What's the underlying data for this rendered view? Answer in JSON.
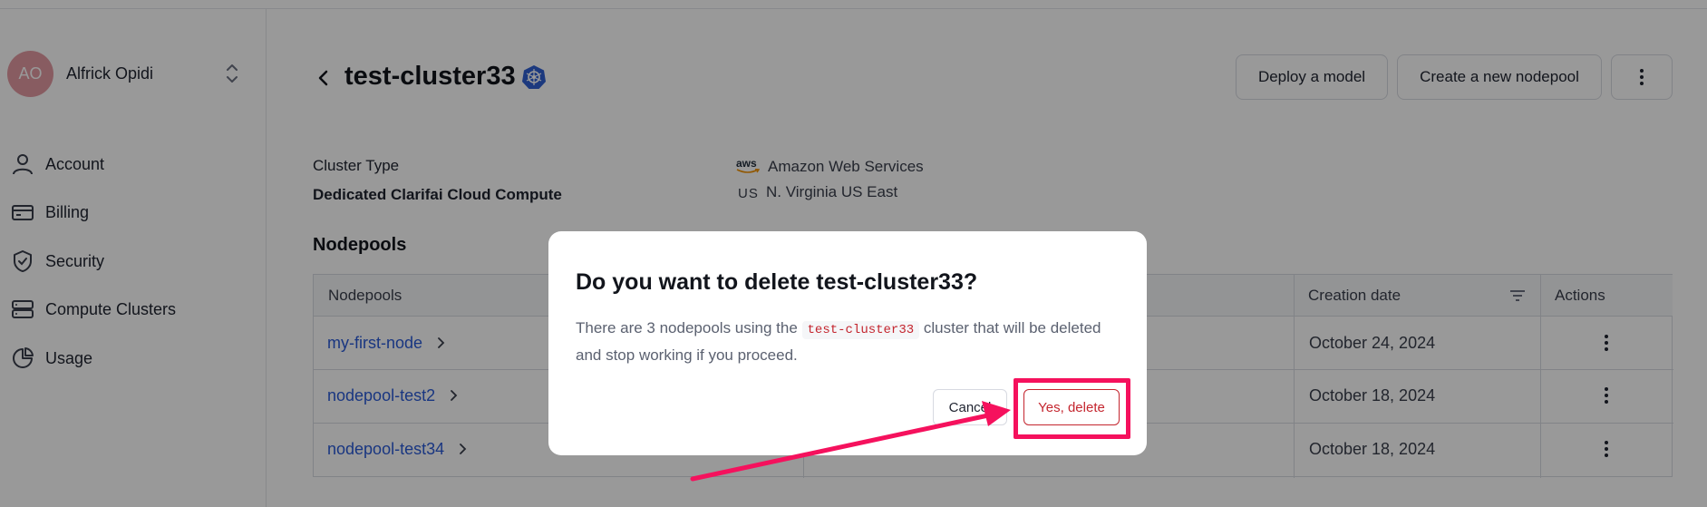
{
  "user": {
    "initials": "AO",
    "name": "Alfrick Opidi"
  },
  "sidebar": {
    "items": [
      {
        "label": "Account",
        "icon": "user-icon"
      },
      {
        "label": "Billing",
        "icon": "credit-card-icon"
      },
      {
        "label": "Security",
        "icon": "shield-icon"
      },
      {
        "label": "Compute Clusters",
        "icon": "server-icon"
      },
      {
        "label": "Usage",
        "icon": "pie-chart-icon"
      }
    ]
  },
  "header": {
    "title": "test-cluster33",
    "deploy_label": "Deploy a model",
    "create_label": "Create a new nodepool"
  },
  "cluster": {
    "type_label": "Cluster Type",
    "type_value": "Dedicated Clarifai Cloud Compute",
    "provider_logo_text": "aws",
    "provider": "Amazon Web Services",
    "region_code": "US",
    "region": "N. Virginia US East"
  },
  "nodepools": {
    "section_title": "Nodepools",
    "columns": [
      "Nodepools",
      "Creation date",
      "Actions"
    ],
    "rows": [
      {
        "name": "my-first-node",
        "date": "October 24, 2024"
      },
      {
        "name": "nodepool-test2",
        "date": "October 18, 2024"
      },
      {
        "name": "nodepool-test34",
        "date": "October 18, 2024"
      }
    ]
  },
  "modal": {
    "title": "Do you want to delete test-cluster33?",
    "body_before": "There are 3 nodepools using the ",
    "body_code": "test-cluster33",
    "body_after": " cluster that will be deleted and stop working if you proceed.",
    "cancel_label": "Cancel",
    "delete_label": "Yes, delete"
  },
  "colors": {
    "accent_link": "#2b5bd7",
    "danger": "#c4262f",
    "annotation": "#f5115d"
  }
}
